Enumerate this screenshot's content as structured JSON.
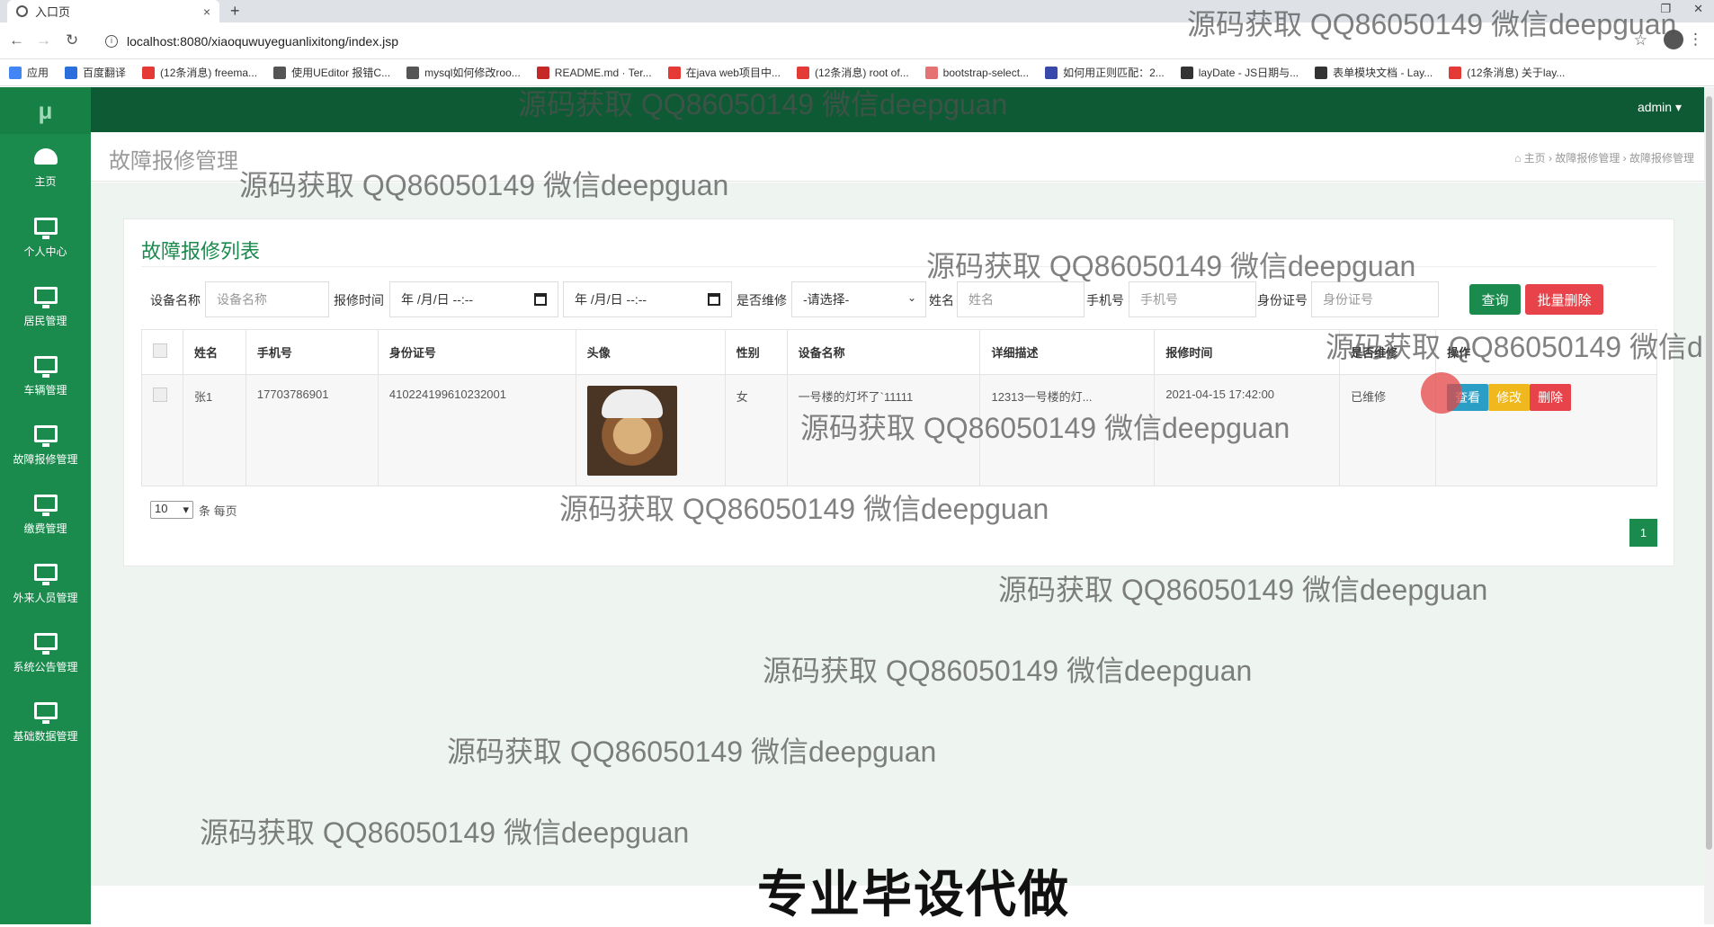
{
  "browser": {
    "tab_title": "入口页",
    "tab_close": "×",
    "new_tab": "+",
    "url": "localhost:8080/xiaoquwuyeguanlixitong/index.jsp",
    "bookmarks": [
      {
        "label": "应用",
        "color": "#4285f4"
      },
      {
        "label": "百度翻译",
        "color": "#2a6fdb"
      },
      {
        "label": "(12条消息) freema...",
        "color": "#e53935"
      },
      {
        "label": "使用UEditor 报错C...",
        "color": "#555555"
      },
      {
        "label": "mysql如何修改roo...",
        "color": "#555555"
      },
      {
        "label": "README.md · Ter...",
        "color": "#c62828"
      },
      {
        "label": "在java web项目中...",
        "color": "#e53935"
      },
      {
        "label": "(12条消息) root of...",
        "color": "#e53935"
      },
      {
        "label": "bootstrap-select...",
        "color": "#e57373"
      },
      {
        "label": "如何用正则匹配：2...",
        "color": "#3949ab"
      },
      {
        "label": "layDate - JS日期与...",
        "color": "#333333"
      },
      {
        "label": "表单模块文档 - Lay...",
        "color": "#333333"
      },
      {
        "label": "(12条消息) 关于lay...",
        "color": "#e53935"
      }
    ]
  },
  "app": {
    "logo": "μ",
    "user_menu": "admin ▾",
    "sidebar": [
      {
        "label": "主页",
        "icon": "dashboard-icon"
      },
      {
        "label": "个人中心",
        "icon": "monitor-icon"
      },
      {
        "label": "居民管理",
        "icon": "monitor-icon"
      },
      {
        "label": "车辆管理",
        "icon": "monitor-icon"
      },
      {
        "label": "故障报修管理",
        "icon": "monitor-icon"
      },
      {
        "label": "缴费管理",
        "icon": "monitor-icon"
      },
      {
        "label": "外来人员管理",
        "icon": "monitor-icon"
      },
      {
        "label": "系统公告管理",
        "icon": "monitor-icon"
      },
      {
        "label": "基础数据管理",
        "icon": "monitor-icon"
      }
    ],
    "page_title": "故障报修管理",
    "breadcrumb": "⌂ 主页  ›  故障报修管理  ›  故障报修管理"
  },
  "panel": {
    "title": "故障报修列表",
    "filters": {
      "device_label": "设备名称",
      "device_placeholder": "设备名称",
      "time_label": "报修时间",
      "date_start": "年 /月/日 --:--",
      "date_end": "年 /月/日 --:--",
      "repaired_label": "是否维修",
      "repaired_value": "-请选择-",
      "name_label": "姓名",
      "name_placeholder": "姓名",
      "phone_label": "手机号",
      "phone_placeholder": "手机号",
      "idcard_label": "身份证号",
      "idcard_placeholder": "身份证号"
    },
    "buttons": {
      "search": "查询",
      "batch_delete": "批量删除"
    },
    "columns": [
      "姓名",
      "手机号",
      "身份证号",
      "头像",
      "性别",
      "设备名称",
      "详细描述",
      "报修时间",
      "是否维修",
      "操作"
    ],
    "rows": [
      {
        "name": "张1",
        "phone": "17703786901",
        "idcard": "410224199610232001",
        "gender": "女",
        "device": "一号楼的灯坏了`11111",
        "description": "12313一号楼的灯...",
        "time": "2021-04-15 17:42:00",
        "repaired": "已维修",
        "actions": {
          "view": "查看",
          "edit": "修改",
          "delete": "删除"
        }
      }
    ],
    "page_size": "10",
    "page_size_suffix": "条 每页",
    "current_page": "1"
  },
  "overlay": {
    "watermark": "源码获取 QQ86050149 微信deepguan",
    "promo": "专业毕设代做"
  },
  "colors": {
    "brand_green": "#1a8a4d",
    "topbar": "#0e5a34",
    "search_btn": "#1a8a4d",
    "danger": "#e8434a",
    "view_btn": "#2a9ec4",
    "edit_btn": "#f0b81c"
  }
}
